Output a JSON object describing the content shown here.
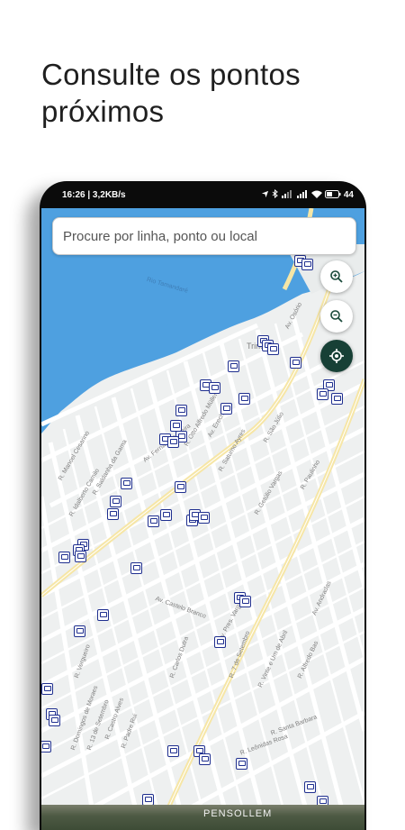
{
  "headline": "Consulte os pontos\npróximos",
  "status_bar": {
    "left_text": "16:26 | 3,2KB/s",
    "battery": "44"
  },
  "search": {
    "placeholder": "Procure por linha, ponto ou local"
  },
  "map_controls": {
    "zoom_in_icon": "zoom-in-icon",
    "zoom_out_icon": "zoom-out-icon",
    "locate_icon": "my-location-icon"
  },
  "map_labels": [
    {
      "text": "Rio Tamandaré"
    },
    {
      "text": "Av. Osório"
    },
    {
      "text": "Trindade"
    },
    {
      "text": "Av. Fernandes Vieira"
    },
    {
      "text": "R. Otto Alfredo Müller"
    },
    {
      "text": "Av. Erechim"
    },
    {
      "text": "R. Saturno Ayres"
    },
    {
      "text": "Av. Sen. Salgado Filho"
    },
    {
      "text": "R. São Júlio"
    },
    {
      "text": "R. Gen. Gomes Carneiro"
    },
    {
      "text": "R. Getúlio Vargas"
    },
    {
      "text": "R. Paulinho"
    },
    {
      "text": "R. Tiradentes"
    },
    {
      "text": "R. Manoel Cesarino"
    },
    {
      "text": "R. Idalberto Camilo"
    },
    {
      "text": "R. Saldanha da Gama"
    },
    {
      "text": "Av. Castelo Branco"
    },
    {
      "text": "Av. Pres. Vargas"
    },
    {
      "text": "R. Carlos Dutra"
    },
    {
      "text": "R. 7 de Setembro"
    },
    {
      "text": "R. Vinte e Um de Abril"
    },
    {
      "text": "R. Tiradentes"
    },
    {
      "text": "R. Alfredo Bas"
    },
    {
      "text": "R. Gen. Osório"
    },
    {
      "text": "R. Vergueiro"
    },
    {
      "text": "R. Domingos de Moraes"
    },
    {
      "text": "R. 13 de Setembro"
    },
    {
      "text": "R. Castro Alves"
    },
    {
      "text": "R. Padre Rui"
    },
    {
      "text": "R. Leônidas Rosa"
    },
    {
      "text": "R. Santa Barbara"
    },
    {
      "text": "R. Ernesto Gomes"
    },
    {
      "text": "R. Carlos Neves"
    },
    {
      "text": "Av. Andradas"
    }
  ],
  "bottom_label": "PENSOLLEM",
  "colors": {
    "water": "#4ea0e0",
    "land": "#eef0f0",
    "road": "#ffffff",
    "main_road": "#f6e6a6",
    "stop_border": "#1f2f8f",
    "locate_button": "#174036"
  }
}
